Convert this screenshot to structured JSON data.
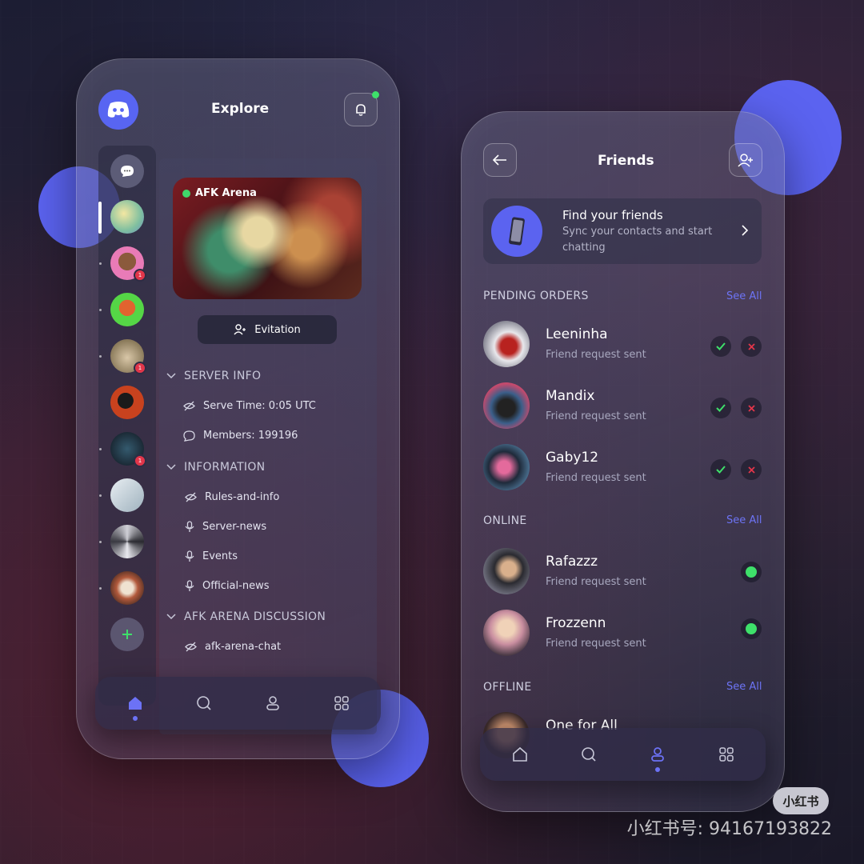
{
  "colors": {
    "accent": "#5b63f0",
    "online": "#3ee06a",
    "decline": "#e2364a",
    "see_all": "#6d74f5"
  },
  "left": {
    "title": "Explore",
    "server_icon": "discord-logo-icon",
    "banner_label": "AFK Arena",
    "invite_button": "Evitation",
    "sections": [
      {
        "title": "SERVER INFO",
        "items": [
          {
            "label": "Serve Time: 0:05 UTC",
            "icon": "eye-off-icon"
          },
          {
            "label": "Members: 199196",
            "icon": "chat-bubble-icon"
          }
        ]
      },
      {
        "title": "INFORMATION",
        "items": [
          {
            "label": "Rules-and-info",
            "icon": "eye-off-icon"
          },
          {
            "label": "Server-news",
            "icon": "mic-icon"
          },
          {
            "label": "Events",
            "icon": "mic-icon"
          },
          {
            "label": "Official-news",
            "icon": "mic-icon"
          }
        ]
      },
      {
        "title": "AFK ARENA DISCUSSION",
        "items": [
          {
            "label": "afk-arena-chat",
            "icon": "eye-off-icon"
          }
        ]
      }
    ],
    "badge_count": "1",
    "nav": [
      "home-icon",
      "search-icon",
      "user-icon",
      "grid-icon"
    ]
  },
  "right": {
    "title": "Friends",
    "find": {
      "title": "Find your friends",
      "subtitle_line1": "Sync your contacts and start",
      "subtitle_line2": "chatting"
    },
    "pending": {
      "label": "PENDING ORDERS",
      "see_all": "See All",
      "items": [
        {
          "name": "Leeninha",
          "status": "Friend request sent"
        },
        {
          "name": "Mandix",
          "status": "Friend request sent"
        },
        {
          "name": "Gaby12",
          "status": "Friend request sent"
        }
      ]
    },
    "online": {
      "label": "ONLINE",
      "see_all": "See All",
      "items": [
        {
          "name": "Rafazzz",
          "status": "Friend request sent"
        },
        {
          "name": "Frozzenn",
          "status": "Friend request sent"
        }
      ]
    },
    "offline": {
      "label": "OFFLINE",
      "see_all": "See All",
      "first_name": "One for All"
    },
    "nav": [
      "home-icon",
      "search-icon",
      "user-icon",
      "grid-icon"
    ]
  },
  "watermark": {
    "logo": "小红书",
    "text": "小红书号: 94167193822"
  }
}
